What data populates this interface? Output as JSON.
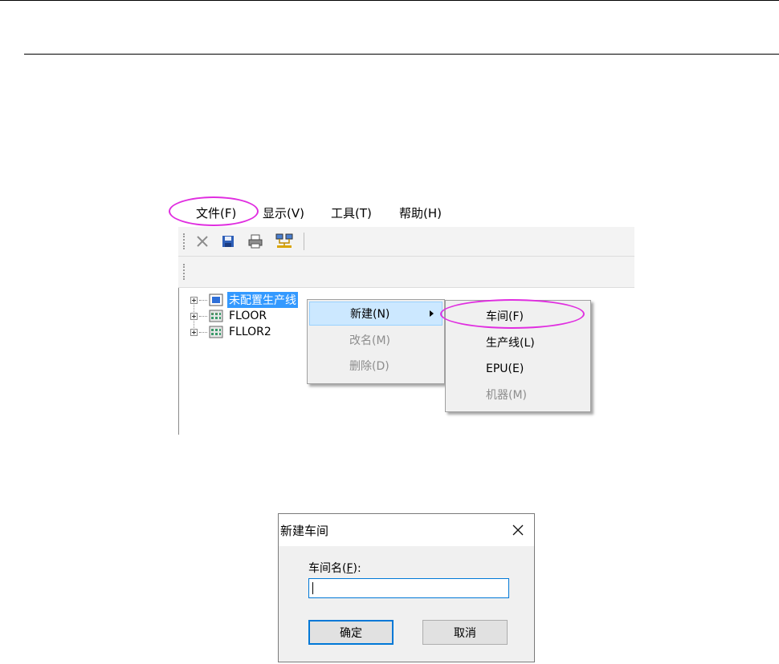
{
  "menubar": {
    "items": [
      "文件(F)",
      "显示(V)",
      "工具(T)",
      "帮助(H)"
    ],
    "highlight_color": "#e02ee0"
  },
  "toolbar": {
    "buttons": [
      "close-icon",
      "save-icon",
      "print-icon",
      "network-icon"
    ]
  },
  "tree": {
    "nodes": [
      {
        "label": "未配置生产线",
        "selected": true
      },
      {
        "label": "FLOOR",
        "selected": false
      },
      {
        "label": "FLLOR2",
        "selected": false
      }
    ],
    "selected_color": "#3399ff"
  },
  "context_menu": {
    "items": [
      {
        "label": "新建(N)",
        "enabled": true,
        "has_submenu": true
      },
      {
        "label": "改名(M)",
        "enabled": false
      },
      {
        "label": "删除(D)",
        "enabled": false
      }
    ]
  },
  "submenu": {
    "items": [
      {
        "label": "车间(F)",
        "enabled": true
      },
      {
        "label": "生产线(L)",
        "enabled": true
      },
      {
        "label": "EPU(E)",
        "enabled": true
      },
      {
        "label": "机器(M)",
        "enabled": false
      }
    ]
  },
  "dialog": {
    "title": "新建车间",
    "label_main": "车间名(",
    "label_key": "F",
    "label_end": "):",
    "input_value": "",
    "ok_label": "确定",
    "cancel_label": "取消",
    "focus_color": "#0078d7"
  }
}
